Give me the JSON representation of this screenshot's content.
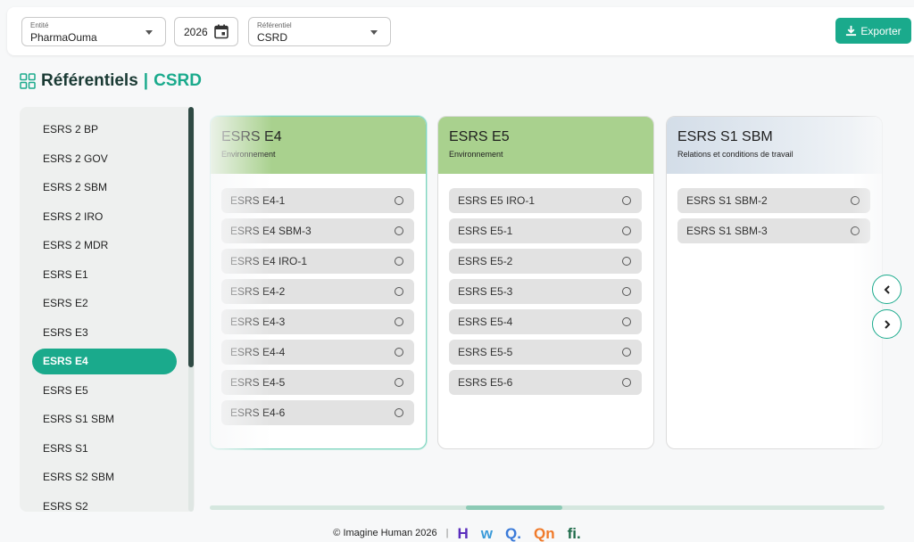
{
  "topbar": {
    "entity": {
      "label": "Entité",
      "value": "PharmaOuma"
    },
    "year": {
      "value": "2026"
    },
    "referential": {
      "label": "Référentiel",
      "value": "CSRD"
    },
    "export_label": "Exporter"
  },
  "heading": {
    "title": "Référentiels",
    "separator": "|",
    "referential": "CSRD"
  },
  "sidebar": {
    "items": [
      {
        "label": "ESRS 2 BP"
      },
      {
        "label": "ESRS 2 GOV"
      },
      {
        "label": "ESRS 2 SBM"
      },
      {
        "label": "ESRS 2 IRO"
      },
      {
        "label": "ESRS 2 MDR"
      },
      {
        "label": "ESRS E1"
      },
      {
        "label": "ESRS E2"
      },
      {
        "label": "ESRS E3"
      },
      {
        "label": "ESRS E4"
      },
      {
        "label": "ESRS E5"
      },
      {
        "label": "ESRS S1 SBM"
      },
      {
        "label": "ESRS S1"
      },
      {
        "label": "ESRS S2 SBM"
      },
      {
        "label": "ESRS S2"
      }
    ],
    "active_index": 8
  },
  "cards": [
    {
      "name": "ESRS E4",
      "subtitle": "Environnement",
      "header_color": "#a9d18e",
      "rows": [
        "ESRS E4-1",
        "ESRS E4 SBM-3",
        "ESRS E4 IRO-1",
        "ESRS E4-2",
        "ESRS E4-3",
        "ESRS E4-4",
        "ESRS E4-5",
        "ESRS E4-6"
      ]
    },
    {
      "name": "ESRS E5",
      "subtitle": "Environnement",
      "header_color": "#a9d18e",
      "rows": [
        "ESRS E5 IRO-1",
        "ESRS E5-1",
        "ESRS E5-2",
        "ESRS E5-3",
        "ESRS E5-4",
        "ESRS E5-5",
        "ESRS E5-6"
      ]
    },
    {
      "name": "ESRS S1 SBM",
      "subtitle": "Relations et conditions de travail",
      "header_color": "#d3dde8",
      "rows": [
        "ESRS S1 SBM-2",
        "ESRS S1 SBM-3"
      ]
    }
  ],
  "footer": {
    "copyright": "© Imagine Human 2026",
    "separator": "|",
    "logos": [
      {
        "text": "H",
        "color": "#5a2dbd"
      },
      {
        "text": "w",
        "color": "#3a9ad9"
      },
      {
        "text": "Q.",
        "color": "#3a7ad9"
      },
      {
        "text": "Qn",
        "color": "#f07a2a"
      },
      {
        "text": "fi.",
        "color": "#1e6b4a"
      }
    ]
  },
  "colors": {
    "accent": "#1aaa8c",
    "dark": "#1a3a34"
  }
}
